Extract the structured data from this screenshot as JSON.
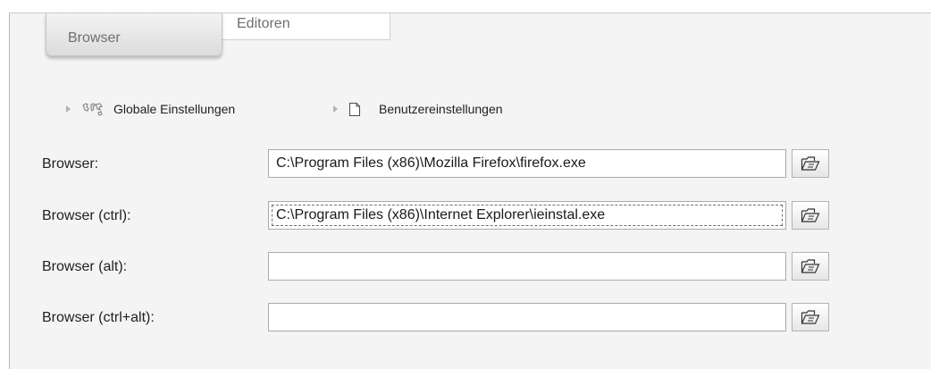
{
  "tabs": [
    {
      "label": "Browser",
      "active": true
    },
    {
      "label": "Editoren",
      "active": false
    }
  ],
  "breadcrumbs": [
    {
      "label": "Globale Einstellungen",
      "icon": "world-map-icon"
    },
    {
      "label": "Benutzereinstellungen",
      "icon": "page-icon"
    }
  ],
  "fields": [
    {
      "label": "Browser:",
      "value": "C:\\Program Files (x86)\\Mozilla Firefox\\firefox.exe",
      "focused": false,
      "button_icon": "open-folder-icon"
    },
    {
      "label": "Browser (ctrl):",
      "value": "C:\\Program Files (x86)\\Internet Explorer\\ieinstal.exe",
      "focused": true,
      "button_icon": "open-folder-icon"
    },
    {
      "label": "Browser (alt):",
      "value": "",
      "focused": false,
      "button_icon": "open-folder-icon"
    },
    {
      "label": "Browser (ctrl+alt):",
      "value": "",
      "focused": false,
      "button_icon": "open-folder-icon"
    }
  ],
  "colors": {
    "panel_background": "#f4f4f4",
    "tab_text": "#6f6f6f",
    "input_border": "#aaaaaa"
  }
}
